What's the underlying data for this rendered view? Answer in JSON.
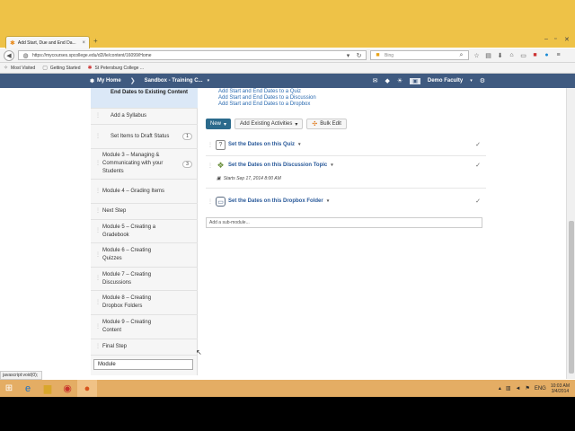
{
  "browser": {
    "tab_title": "Add Start, Due and End Da...",
    "tab_close": "×",
    "new_tab": "+",
    "url": "https://mycourses.spcollege.edu/d2l/le/content/16099/Home",
    "search_placeholder": "Bing",
    "bookmarks": [
      {
        "label": "Most Visited",
        "icon": "star-icon"
      },
      {
        "label": "Getting Started",
        "icon": "page-icon"
      },
      {
        "label": "St Petersburg College ...",
        "icon": "st-icon"
      }
    ]
  },
  "d2l": {
    "home_label": "My Home",
    "course_label": "Sandbox - Training C...",
    "user_label": "Demo Faculty"
  },
  "sidebar": {
    "selected": "End Dates to Existing Content",
    "items": [
      {
        "label": "Add a Syllabus",
        "count": ""
      },
      {
        "label": "Set Items to Draft Status",
        "count": "1"
      },
      {
        "label": "Module 3 – Managing & Communicating with your Students",
        "count": "3"
      },
      {
        "label": "Module 4 – Grading Items",
        "count": ""
      },
      {
        "label": "Next Step",
        "count": ""
      },
      {
        "label": "Module 5 – Creating a Gradebook",
        "count": ""
      },
      {
        "label": "Module 6 – Creating Quizzes",
        "count": ""
      },
      {
        "label": "Module 7 – Creating Discussions",
        "count": ""
      },
      {
        "label": "Module 8 – Creating Dropbox Folders",
        "count": ""
      },
      {
        "label": "Module 9 – Creating Content",
        "count": ""
      },
      {
        "label": "Final Step",
        "count": ""
      }
    ],
    "input_value": "Module"
  },
  "main": {
    "sublinks": [
      "Add Start and End Dates to a Quiz",
      "Add Start and End Dates to a Discussion",
      "Add Start and End Dates to a Dropbox"
    ],
    "toolbar": {
      "new_label": "New",
      "add_existing_label": "Add Existing Activities",
      "bulk_edit_label": "Bulk Edit"
    },
    "topics": [
      {
        "title": "Set the Dates on this Quiz",
        "icon": "quiz-icon"
      },
      {
        "title": "Set the Dates on this Discussion Topic",
        "icon": "discussion-icon"
      },
      {
        "title": "Set the Dates on this Dropbox Folder",
        "icon": "dropbox-icon"
      }
    ],
    "starts_text": "Starts Sep 17, 2014 8:00 AM",
    "submodule_placeholder": "Add a sub-module..."
  },
  "status_text": "javascript:void(0);",
  "taskbar": {
    "lang": "ENG",
    "time": "10:03 AM",
    "date": "3/4/2014"
  },
  "colors": {
    "d2l_bar": "#3f5a80",
    "browser_chrome": "#eec247",
    "taskbar": "#e4ad64",
    "link": "#2a6ab0"
  }
}
